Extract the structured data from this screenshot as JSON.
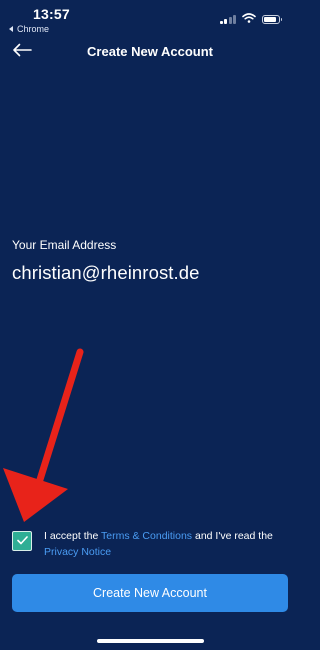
{
  "status_bar": {
    "time": "13:57",
    "back_app_label": "Chrome",
    "battery_level": 0.85,
    "signal_bars_active": 2,
    "icons": [
      "signal-icon",
      "wifi-icon",
      "battery-icon"
    ]
  },
  "nav": {
    "title": "Create New Account",
    "back_icon": "arrow-left-icon"
  },
  "email": {
    "label": "Your Email Address",
    "value": "christian@rheinrost.de"
  },
  "terms": {
    "checked": true,
    "text_part1": "I accept the ",
    "terms_link": "Terms & Conditions",
    "text_part2": " and I've read the ",
    "privacy_link": "Privacy Notice"
  },
  "primary_button": {
    "label": "Create New Account"
  },
  "colors": {
    "background": "#0b2455",
    "accent": "#2f8ae6",
    "link": "#4a9cf3",
    "checkbox": "#2fae95",
    "annotation_arrow": "#e8231a"
  }
}
